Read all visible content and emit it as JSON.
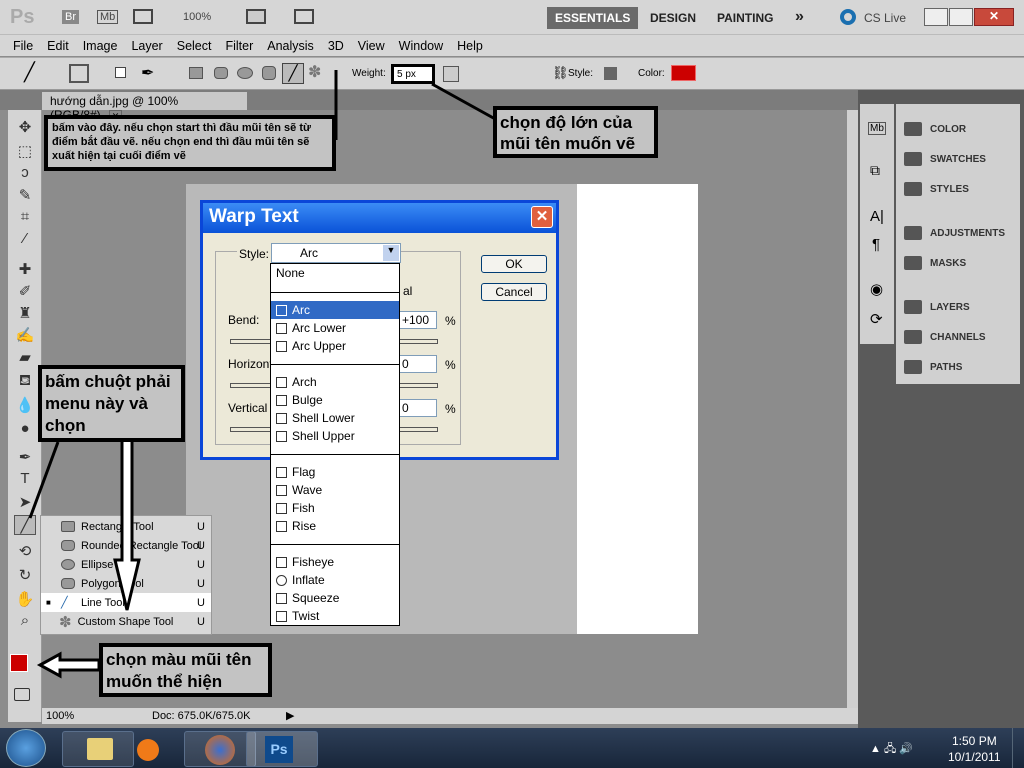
{
  "app": {
    "logo": "Ps",
    "bridge": "Br",
    "minibridge": "Mb",
    "zoom": "100%"
  },
  "workspaces": [
    "ESSENTIALS",
    "DESIGN",
    "PAINTING"
  ],
  "workspace_more": "»",
  "cs_live": "CS Live",
  "menu": [
    "File",
    "Edit",
    "Image",
    "Layer",
    "Select",
    "Filter",
    "Analysis",
    "3D",
    "View",
    "Window",
    "Help"
  ],
  "options": {
    "weight_label": "Weight:",
    "weight_value": "5 px",
    "style_label": "Style:",
    "color_label": "Color:",
    "color": "#cc0000"
  },
  "document": {
    "tab": "hướng dẫn.jpg @ 100% (RGB/8#)",
    "status_zoom": "100%",
    "doc_size": "Doc: 675.0K/675.0K"
  },
  "panels": [
    {
      "label": "COLOR",
      "icon": "color-icon"
    },
    {
      "label": "SWATCHES",
      "icon": "swatches-icon"
    },
    {
      "label": "STYLES",
      "icon": "styles-icon"
    },
    {
      "label": "ADJUSTMENTS",
      "icon": "adjustments-icon"
    },
    {
      "label": "MASKS",
      "icon": "masks-icon"
    },
    {
      "label": "LAYERS",
      "icon": "layers-icon"
    },
    {
      "label": "CHANNELS",
      "icon": "channels-icon"
    },
    {
      "label": "PATHS",
      "icon": "paths-icon"
    }
  ],
  "warp": {
    "title": "Warp Text",
    "style_label": "Style:",
    "style_value": "Arc",
    "ok": "OK",
    "cancel": "Cancel",
    "bend_label": "Bend:",
    "bend_value": "+100",
    "horizontal_label": "Horizont",
    "vertical_label": "Vertical",
    "pct": "%",
    "h_value": "0",
    "v_value": "0",
    "radio_partial": "al",
    "options": [
      [
        "None"
      ],
      [
        "Arc",
        "Arc Lower",
        "Arc Upper"
      ],
      [
        "Arch",
        "Bulge",
        "Shell Lower",
        "Shell Upper"
      ],
      [
        "Flag",
        "Wave",
        "Fish",
        "Rise"
      ],
      [
        "Fisheye",
        "Inflate",
        "Squeeze",
        "Twist"
      ]
    ]
  },
  "flyout": [
    {
      "label": "Rectangle Tool",
      "key": "U"
    },
    {
      "label": "Rounded Rectangle Tool",
      "key": "U"
    },
    {
      "label": "Ellipse Tool",
      "key": "U"
    },
    {
      "label": "Polygon Tool",
      "key": "U"
    },
    {
      "label": "Line Tool",
      "key": "U",
      "selected": true
    },
    {
      "label": "Custom Shape Tool",
      "key": "U"
    }
  ],
  "notes": {
    "arrowhead": "bấm vào đây. nếu chọn start thì đầu mũi tên sẽ từ điểm bắt đầu vẽ. nếu chọn end thì đầu mũi tên sẽ xuất hiện tại cuối điểm vẽ",
    "weight": "chọn độ lớn của mũi tên muốn vẽ",
    "rightclick": "bấm chuột phải menu này và chọn",
    "color": "chọn màu mũi tên muốn thể hiện"
  },
  "colors": {
    "foreground": "#cc0000",
    "background": "#ffffff"
  },
  "clock": {
    "time": "1:50 PM",
    "date": "10/1/2011"
  }
}
